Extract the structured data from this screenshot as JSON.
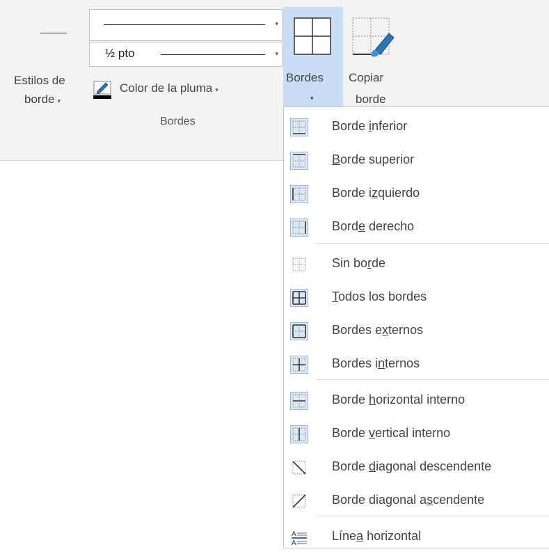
{
  "ribbon": {
    "line_style_label_1": "Estilos de",
    "line_style_label_2": "borde",
    "dropdown_arrow": "▾",
    "line_weight_value": "½ pto",
    "pen_color_label": "Color de la pluma",
    "group_label": "Bordes",
    "borders_button_label": "Bordes",
    "borders_button_arrow": "▾",
    "copy_border_label_1": "Copiar",
    "copy_border_label_2": "borde"
  },
  "menu": {
    "items": [
      {
        "pre": "Borde ",
        "key": "i",
        "post": "nferior",
        "icon": "border-bottom-icon"
      },
      {
        "pre": "",
        "key": "B",
        "post": "orde superior",
        "icon": "border-top-icon"
      },
      {
        "pre": "Borde i",
        "key": "z",
        "post": "quierdo",
        "icon": "border-left-icon"
      },
      {
        "pre": "Bord",
        "key": "e",
        "post": " derecho",
        "icon": "border-right-icon"
      },
      {
        "pre": "Sin bo",
        "key": "r",
        "post": "de",
        "icon": "no-border-icon"
      },
      {
        "pre": "",
        "key": "T",
        "post": "odos los bordes",
        "icon": "all-borders-icon"
      },
      {
        "pre": "Bordes e",
        "key": "x",
        "post": "ternos",
        "icon": "outside-borders-icon"
      },
      {
        "pre": "Bordes i",
        "key": "n",
        "post": "ternos",
        "icon": "inside-borders-icon"
      },
      {
        "pre": "Borde ",
        "key": "h",
        "post": "orizontal interno",
        "icon": "inside-horizontal-border-icon"
      },
      {
        "pre": "Borde ",
        "key": "v",
        "post": "ertical interno",
        "icon": "inside-vertical-border-icon"
      },
      {
        "pre": "Borde ",
        "key": "d",
        "post": "iagonal descendente",
        "icon": "diagonal-down-border-icon"
      },
      {
        "pre": "Borde diagonal a",
        "key": "s",
        "post": "cendente",
        "icon": "diagonal-up-border-icon"
      },
      {
        "pre": "Líne",
        "key": "a",
        "post": " horizontal",
        "icon": "horizontal-line-icon"
      }
    ]
  },
  "colors": {
    "ribbon_bg": "#f3f3f3",
    "selected_button_bg": "#c9def5",
    "icon_tile_bg": "#dbe8f6",
    "icon_tile_border": "#9fbad8",
    "pen_blue": "#2e75b6"
  }
}
